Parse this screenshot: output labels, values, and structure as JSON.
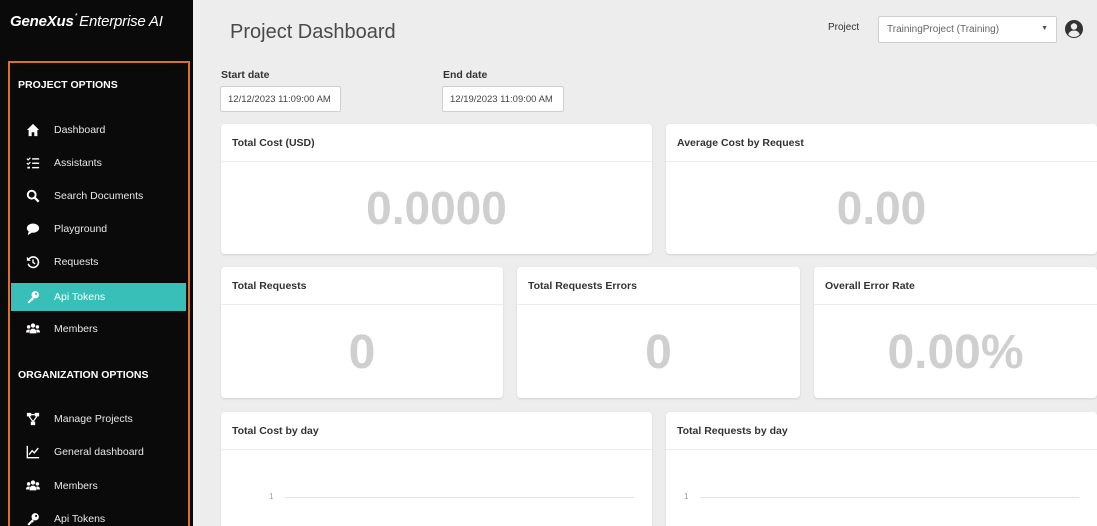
{
  "brand": {
    "name_bold": "GeneXus",
    "name_rest": "Enterprise AI",
    "mark": "*"
  },
  "sidebar": {
    "project_section": "PROJECT OPTIONS",
    "project_items": [
      {
        "label": "Dashboard",
        "icon": "home-icon"
      },
      {
        "label": "Assistants",
        "icon": "checklist-icon"
      },
      {
        "label": "Search Documents",
        "icon": "search-icon"
      },
      {
        "label": "Playground",
        "icon": "chat-bubble-icon"
      },
      {
        "label": "Requests",
        "icon": "history-icon"
      },
      {
        "label": "Api Tokens",
        "icon": "key-icon",
        "active": true
      },
      {
        "label": "Members",
        "icon": "users-icon"
      }
    ],
    "org_section": "ORGANIZATION OPTIONS",
    "org_items": [
      {
        "label": "Manage Projects",
        "icon": "project-tree-icon"
      },
      {
        "label": "General dashboard",
        "icon": "line-chart-icon"
      },
      {
        "label": "Members",
        "icon": "users-icon"
      },
      {
        "label": "Api Tokens",
        "icon": "key-icon"
      }
    ]
  },
  "header": {
    "title": "Project Dashboard",
    "project_label": "Project",
    "project_value": "TrainingProject (Training)",
    "user_icon": "user-circle-icon"
  },
  "filters": {
    "start_label": "Start date",
    "start_value": "12/12/2023 11:09:00 AM",
    "end_label": "End date",
    "end_value": "12/19/2023 11:09:00 AM"
  },
  "cards": {
    "total_cost": {
      "title": "Total Cost (USD)",
      "value": "0.0000"
    },
    "avg_cost": {
      "title": "Average Cost by Request",
      "value": "0.00"
    },
    "total_requests": {
      "title": "Total Requests",
      "value": "0"
    },
    "request_errors": {
      "title": "Total Requests Errors",
      "value": "0"
    },
    "error_rate": {
      "title": "Overall Error Rate",
      "value": "0.00%"
    },
    "cost_by_day": {
      "title": "Total Cost by day",
      "tick": "1"
    },
    "requests_by_day": {
      "title": "Total Requests by day",
      "tick": "1"
    }
  },
  "colors": {
    "accent": "#38bfb8",
    "frame": "#d8722a",
    "sidebar_bg": "#0a0a0a"
  }
}
